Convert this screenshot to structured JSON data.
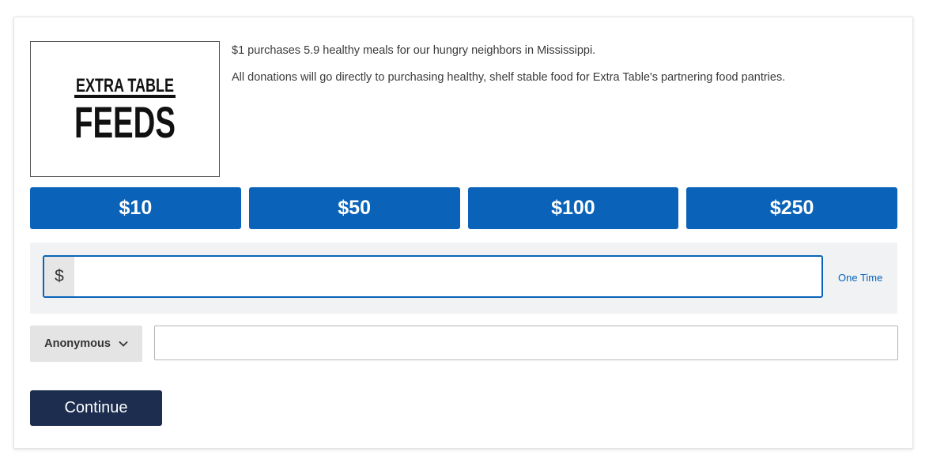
{
  "logo": {
    "icon": "extra-table-feeds-logo",
    "line1": "EXTRA TABLE",
    "line2": "FEEDS"
  },
  "description": {
    "impact": "$1 purchases 5.9 healthy meals for our hungry neighbors in Mississippi.",
    "purpose": "All donations will go directly to purchasing healthy, shelf stable food for Extra Table's partnering food pantries."
  },
  "amounts": [
    {
      "label": "$10"
    },
    {
      "label": "$50"
    },
    {
      "label": "$100"
    },
    {
      "label": "$250"
    }
  ],
  "custom_amount": {
    "currency_symbol": "$",
    "value": "",
    "frequency_label": "One Time"
  },
  "donor": {
    "visibility_selected": "Anonymous",
    "name_value": ""
  },
  "actions": {
    "continue_label": "Continue"
  },
  "colors": {
    "primary_blue": "#0a63b8",
    "continue_navy": "#1c2d4f",
    "panel_gray": "#f0f2f3"
  }
}
